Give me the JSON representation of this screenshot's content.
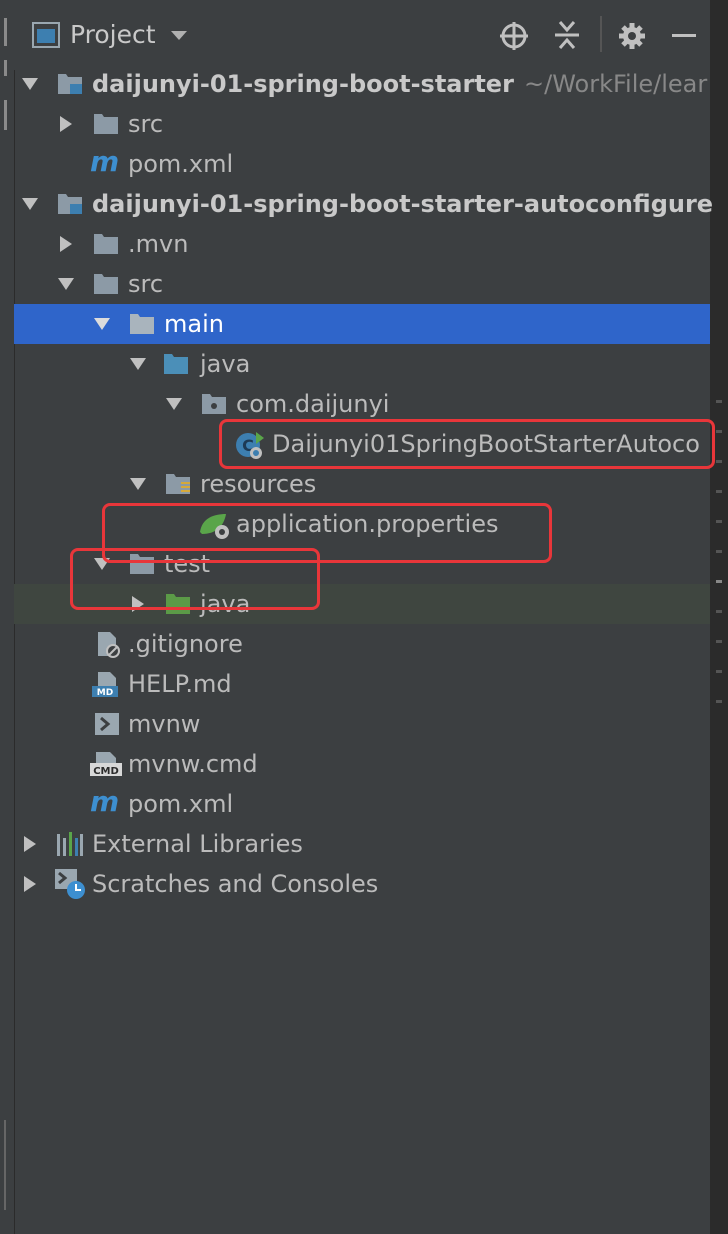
{
  "header": {
    "title": "Project",
    "icons": [
      "project-window-icon",
      "dropdown-icon",
      "locate-icon",
      "collapse-icon",
      "gear-icon",
      "minimize-icon"
    ]
  },
  "tree": {
    "rows": [
      {
        "label": "daijunyi-01-spring-boot-starter",
        "path": "~/WorkFile/lear"
      },
      {
        "label": "src"
      },
      {
        "label": "pom.xml"
      },
      {
        "label": "daijunyi-01-spring-boot-starter-autoconfigure"
      },
      {
        "label": ".mvn"
      },
      {
        "label": "src"
      },
      {
        "label": "main"
      },
      {
        "label": "java"
      },
      {
        "label": "com.daijunyi"
      },
      {
        "label": "Daijunyi01SpringBootStarterAutoco"
      },
      {
        "label": "resources"
      },
      {
        "label": "application.properties"
      },
      {
        "label": "test"
      },
      {
        "label": "java"
      },
      {
        "label": ".gitignore"
      },
      {
        "label": "HELP.md"
      },
      {
        "label": "mvnw"
      },
      {
        "label": "mvnw.cmd"
      },
      {
        "label": "pom.xml"
      },
      {
        "label": "External Libraries"
      },
      {
        "label": "Scratches and Consoles"
      }
    ]
  },
  "colors": {
    "background": "#3c3f41",
    "selection": "#2f65ca",
    "highlight": "#e8363a",
    "folder": "#8c9aa6",
    "source_folder": "#4b8fb8",
    "test_folder": "#5b9a47"
  }
}
